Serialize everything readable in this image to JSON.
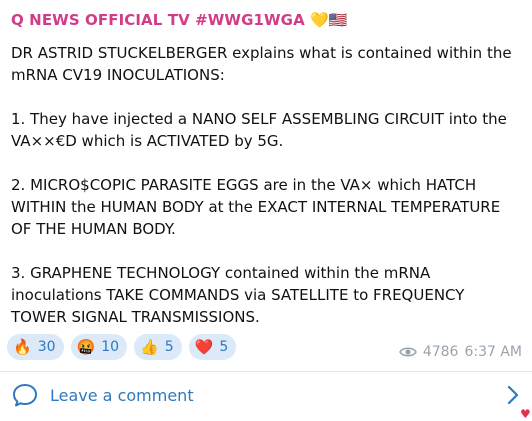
{
  "post": {
    "channel_name": "Q NEWS OFFICIAL TV #WWG1WGA",
    "channel_emojis": "💛🇺🇸",
    "paragraphs": [
      "DR ASTRID STUCKELBERGER  explains what is contained within the mRNA CV19 INOCULATIONS:",
      "1. They have injected a NANO SELF ASSEMBLING CIRCUIT into the VA××€D which is ACTIVATED by 5G.",
      "2. MICRO$COPIC PARASITE EGGS are in the VA× which  HATCH WITHIN the HUMAN BODY at the EXACT INTERNAL TEMPERATURE OF THE HUMAN BODY.",
      "3. GRAPHENE TECHNOLOGY contained within the mRNA inoculations TAKE COMMANDS via SATELLITE to FREQUENCY TOWER SIGNAL TRANSMISSIONS."
    ],
    "reactions": [
      {
        "emoji": "🔥",
        "icon": "fire-icon",
        "count": "30"
      },
      {
        "emoji": "🤬",
        "icon": "cursing-face-icon",
        "count": "10"
      },
      {
        "emoji": "👍",
        "icon": "thumbs-up-icon",
        "count": "5"
      },
      {
        "emoji": "❤️",
        "icon": "heart-icon",
        "count": "5"
      }
    ],
    "views": "4786",
    "time": "6:37 AM"
  },
  "comments": {
    "label": "Leave a comment"
  },
  "colors": {
    "channel_name": "#d13c86",
    "accent": "#2f78c0",
    "reaction_bg": "#dbe9f8",
    "meta": "#9aa3ad"
  }
}
